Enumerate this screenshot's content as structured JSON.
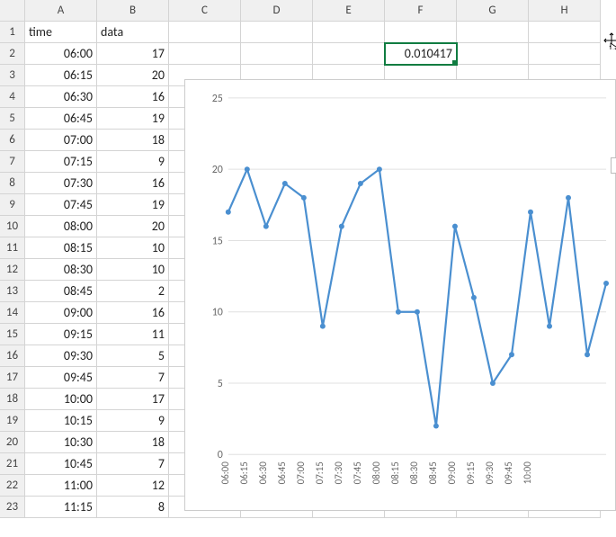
{
  "columns": [
    "A",
    "B",
    "C",
    "D",
    "E",
    "F",
    "G",
    "H"
  ],
  "rows_count": 23,
  "header": {
    "A": "time",
    "B": "data"
  },
  "active_cell": {
    "col": "F",
    "row": 2,
    "value": "0.010417"
  },
  "table": [
    {
      "time": "06:00",
      "data": 17
    },
    {
      "time": "06:15",
      "data": 20
    },
    {
      "time": "06:30",
      "data": 16
    },
    {
      "time": "06:45",
      "data": 19
    },
    {
      "time": "07:00",
      "data": 18
    },
    {
      "time": "07:15",
      "data": 9
    },
    {
      "time": "07:30",
      "data": 16
    },
    {
      "time": "07:45",
      "data": 19
    },
    {
      "time": "08:00",
      "data": 20
    },
    {
      "time": "08:15",
      "data": 10
    },
    {
      "time": "08:30",
      "data": 10
    },
    {
      "time": "08:45",
      "data": 2
    },
    {
      "time": "09:00",
      "data": 16
    },
    {
      "time": "09:15",
      "data": 11
    },
    {
      "time": "09:30",
      "data": 5
    },
    {
      "time": "09:45",
      "data": 7
    },
    {
      "time": "10:00",
      "data": 17
    },
    {
      "time": "10:15",
      "data": 9
    },
    {
      "time": "10:30",
      "data": 18
    },
    {
      "time": "10:45",
      "data": 7
    },
    {
      "time": "11:00",
      "data": 12
    },
    {
      "time": "11:15",
      "data": 8
    }
  ],
  "chart_data": {
    "type": "line",
    "xlabel": "",
    "ylabel": "",
    "ylim": [
      0,
      25
    ],
    "yticks": [
      0,
      5,
      10,
      15,
      20,
      25
    ],
    "categories": [
      "06:00",
      "06:15",
      "06:30",
      "06:45",
      "07:00",
      "07:15",
      "07:30",
      "07:45",
      "08:00",
      "08:15",
      "08:30",
      "08:45",
      "09:00",
      "09:15",
      "09:30",
      "09:45",
      "10:00"
    ],
    "visible_values": [
      17,
      20,
      16,
      19,
      18,
      9,
      16,
      19,
      20,
      10,
      10,
      2,
      16,
      11,
      5,
      7,
      17,
      9,
      18,
      7,
      12
    ],
    "series_color": "#4a8fd0"
  }
}
